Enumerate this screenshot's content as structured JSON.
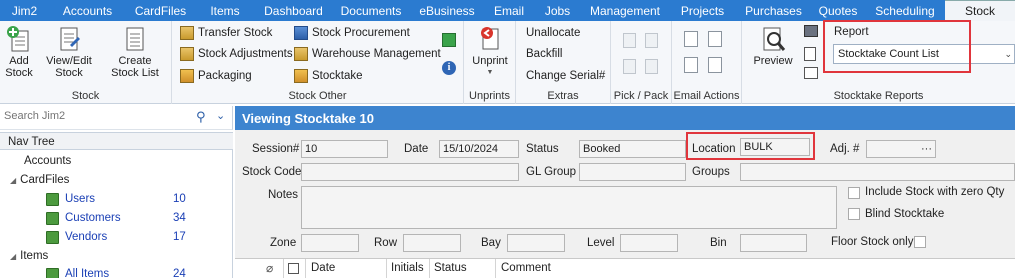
{
  "menubar": {
    "items": [
      {
        "label": "Jim2",
        "width": 49
      },
      {
        "label": "Accounts",
        "width": 77
      },
      {
        "label": "CardFiles",
        "width": 69
      },
      {
        "label": "Items",
        "width": 60
      },
      {
        "label": "Dashboard",
        "width": 77
      },
      {
        "label": "Documents",
        "width": 78
      },
      {
        "label": "eBusiness",
        "width": 74
      },
      {
        "label": "Email",
        "width": 50
      },
      {
        "label": "Jobs",
        "width": 47
      },
      {
        "label": "Management",
        "width": 88
      },
      {
        "label": "Projects",
        "width": 67
      },
      {
        "label": "Purchases",
        "width": 75
      },
      {
        "label": "Quotes",
        "width": 54
      },
      {
        "label": "Scheduling",
        "width": 80
      },
      {
        "label": "Stock",
        "width": 70
      }
    ],
    "active_index": 14
  },
  "ribbon": {
    "stock": {
      "add_stock": "Add Stock",
      "view_edit_stock": "View/Edit Stock",
      "create_stock_list": "Create Stock List",
      "label": "Stock"
    },
    "stock_other": {
      "transfer_stock": "Transfer Stock",
      "stock_adjustments": "Stock Adjustments",
      "packaging": "Packaging",
      "stock_procurement": "Stock Procurement",
      "warehouse_management": "Warehouse Management",
      "stocktake": "Stocktake",
      "label": "Stock Other"
    },
    "unprints": {
      "unprint": "Unprint",
      "label": "Unprints"
    },
    "extras": {
      "unallocate": "Unallocate",
      "backfill": "Backfill",
      "change_serial": "Change Serial#",
      "label": "Extras"
    },
    "pick_pack": {
      "label": "Pick / Pack"
    },
    "email_actions": {
      "label": "Email Actions"
    },
    "stocktake_reports": {
      "preview": "Preview",
      "report_label": "Report",
      "report_value": "Stocktake Count List",
      "label": "Stocktake Reports"
    }
  },
  "nav": {
    "search_placeholder": "Search Jim2",
    "tree_header": "Nav Tree",
    "items": {
      "accounts": "Accounts",
      "cardfiles": "CardFiles",
      "users": {
        "label": "Users",
        "count": "10"
      },
      "customers": {
        "label": "Customers",
        "count": "34"
      },
      "vendors": {
        "label": "Vendors",
        "count": "17"
      },
      "items": "Items",
      "all_items": {
        "label": "All Items",
        "count": "24"
      }
    }
  },
  "main": {
    "title": "Viewing Stocktake 10",
    "labels": {
      "session": "Session#",
      "date": "Date",
      "status": "Status",
      "location": "Location",
      "adj": "Adj. #",
      "stock_code": "Stock Code",
      "gl_group": "GL Group",
      "groups": "Groups",
      "notes": "Notes",
      "include_zero": "Include Stock with zero Qty",
      "blind": "Blind Stocktake",
      "zone": "Zone",
      "row": "Row",
      "bay": "Bay",
      "level": "Level",
      "bin": "Bin",
      "floor_stock": "Floor Stock only"
    },
    "values": {
      "session": "10",
      "date": "15/10/2024",
      "status": "Booked",
      "location": "BULK",
      "adj_btn": "···"
    },
    "grid_columns": [
      "Date",
      "Initials",
      "Status",
      "Comment"
    ]
  }
}
